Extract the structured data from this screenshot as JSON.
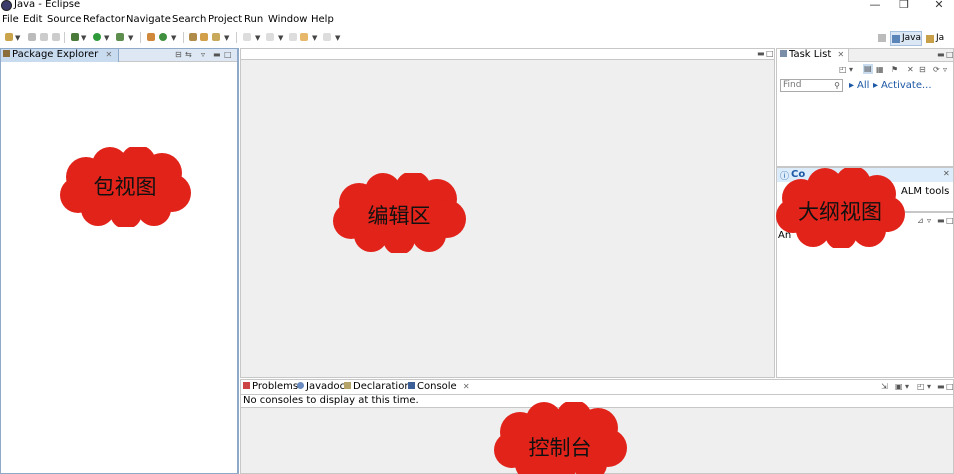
{
  "window": {
    "title": "Java - Eclipse",
    "minimize": "—",
    "restore": "❐",
    "close": "✕"
  },
  "menu": [
    "File",
    "Edit",
    "Source",
    "Refactor",
    "Navigate",
    "Search",
    "Project",
    "Run",
    "Window",
    "Help"
  ],
  "perspectives": {
    "java": "Java",
    "java_ee": "Ja"
  },
  "package_explorer": {
    "tab_label": "Package Explorer",
    "close": "✕"
  },
  "task_list": {
    "tab_label": "Task List",
    "find_placeholder": "Find",
    "all_link": "All",
    "activate_link": "Activate..."
  },
  "connect_mylyn": {
    "title": "Co",
    "text": "ALM tools"
  },
  "outline": {
    "text": "An"
  },
  "console": {
    "tabs": [
      "Problems",
      "Javadoc",
      "Declaration",
      "Console"
    ],
    "message": "No consoles to display at this time."
  },
  "annotations": {
    "package_view": "包视图",
    "editor_area": "编辑区",
    "outline_view": "大纲视图",
    "console_area": "控制台"
  },
  "colors": {
    "annotation_cloud": "#e2231a",
    "selection": "#c9dbef",
    "link": "#1c57a5"
  },
  "icons": [
    "eclipse-logo-icon",
    "new-icon",
    "save-icon",
    "debug-icon",
    "run-icon",
    "search-icon",
    "package-icon",
    "tasklist-icon",
    "connect-info-icon",
    "problems-icon",
    "javadoc-icon",
    "declaration-icon",
    "console-icon"
  ]
}
